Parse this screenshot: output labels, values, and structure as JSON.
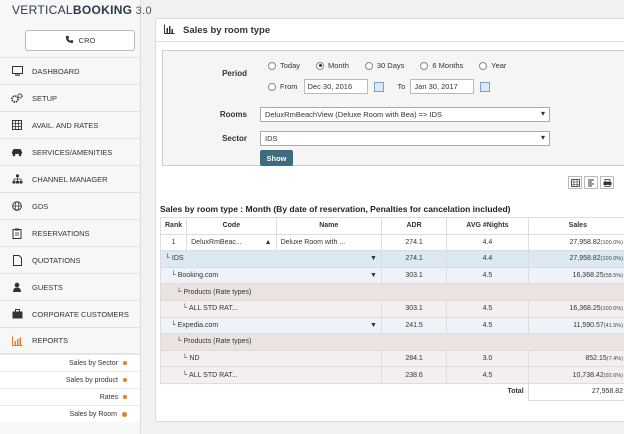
{
  "brand": {
    "name_light": "VERTICAL",
    "name_bold": "BOOKING",
    "version": " 3.0"
  },
  "cro_label": "CRO",
  "nav": [
    {
      "id": "dashboard",
      "label": "DASHBOARD",
      "icon": "monitor-icon"
    },
    {
      "id": "setup",
      "label": "SETUP",
      "icon": "gears-icon"
    },
    {
      "id": "avail",
      "label": "AVAIL. AND RATES",
      "icon": "calendar-grid-icon"
    },
    {
      "id": "services",
      "label": "SERVICES/AMENITIES",
      "icon": "car-icon"
    },
    {
      "id": "channel",
      "label": "CHANNEL MANAGER",
      "icon": "sitemap-icon"
    },
    {
      "id": "gds",
      "label": "GDS",
      "icon": "globe-icon"
    },
    {
      "id": "reservations",
      "label": "RESERVATIONS",
      "icon": "clipboard-icon"
    },
    {
      "id": "quotations",
      "label": "QUOTATIONS",
      "icon": "document-icon"
    },
    {
      "id": "guests",
      "label": "GUESTS",
      "icon": "user-icon"
    },
    {
      "id": "corporate",
      "label": "CORPORATE CUSTOMERS",
      "icon": "briefcase-icon"
    },
    {
      "id": "reports",
      "label": "REPORTS",
      "icon": "bar-chart-icon"
    }
  ],
  "subnav": [
    {
      "label": "Sales by Sector"
    },
    {
      "label": "Sales by product"
    },
    {
      "label": "Rates"
    },
    {
      "label": "Sales by Room"
    }
  ],
  "panel_title": "Sales by room type",
  "form": {
    "period_label": "Period",
    "period_options": [
      "Today",
      "Month",
      "30 Days",
      "6 Months",
      "Year"
    ],
    "selected_period": "Month",
    "from_label": "From",
    "from_value": "Dec 30, 2016",
    "to_label": "To",
    "to_value": "Jan 30, 2017",
    "rooms_label": "Rooms",
    "rooms_value": "DeluxRmBeachView (Deluxe Room with Bea) => IDS",
    "sector_label": "Sector",
    "sector_value": "IDS",
    "show_label": "Show"
  },
  "report_title": "Sales by room type : Month (By date of reservation, Penalties for cancelation included)",
  "table": {
    "headers": {
      "rank": "Rank",
      "code": "Code",
      "name": "Name",
      "adr": "ADR",
      "nights": "AVG #Nights",
      "sales": "Sales"
    },
    "rows": [
      {
        "rank": "1",
        "code": "DeluxRmBeac...",
        "name": "Deluxe Room with ...",
        "adr": "274.1",
        "nights": "4.4",
        "sales": "27,958.82",
        "pct": "(100.0%)"
      },
      {
        "label": "IDS",
        "adr": "274.1",
        "nights": "4.4",
        "sales": "27,958.82",
        "pct": "(100.0%)"
      },
      {
        "label": "Booking.com",
        "adr": "303.1",
        "nights": "4.5",
        "sales": "16,368.25",
        "pct": "(58.5%)"
      },
      {
        "label": "Products (Rate types)"
      },
      {
        "label": "ALL STD RAT...",
        "adr": "303.1",
        "nights": "4.5",
        "sales": "16,368.25",
        "pct": "(100.0%)"
      },
      {
        "label": "Expedia.com",
        "adr": "241.5",
        "nights": "4.5",
        "sales": "11,590.57",
        "pct": "(41.5%)"
      },
      {
        "label": "Products (Rate types)"
      },
      {
        "label": "ND",
        "adr": "284.1",
        "nights": "3.0",
        "sales": "852.15",
        "pct": "(7.4%)"
      },
      {
        "label": "ALL STD RAT...",
        "adr": "238.6",
        "nights": "4.5",
        "sales": "10,738.42",
        "pct": "(92.6%)"
      }
    ],
    "total_label": "Total",
    "total_value": "27,958.82"
  },
  "colors": {
    "accent": "#e67e22",
    "show_button": "#3d6b80",
    "ids_row": "#dce9f5",
    "product_row": "#eae3e2"
  }
}
